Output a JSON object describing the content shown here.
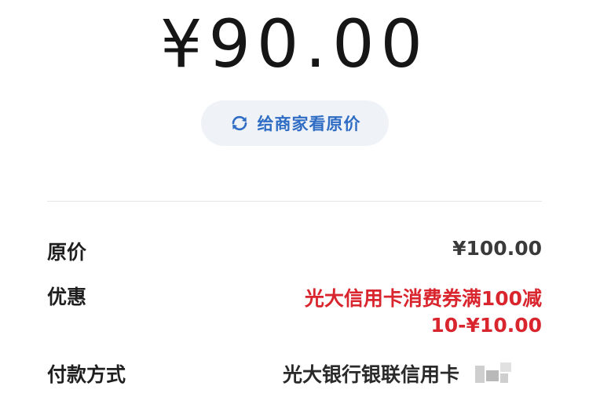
{
  "amount": "¥90.00",
  "show_original_button": {
    "label": "给商家看原价",
    "icon": "refresh-icon",
    "color": "#2f6dc4"
  },
  "details": {
    "original_price": {
      "label": "原价",
      "value": "¥100.00"
    },
    "discount": {
      "label": "优惠",
      "value_line1": "光大信用卡消费券满100减",
      "value_line2": "10-¥10.00",
      "color": "#d9252d"
    },
    "payment_method": {
      "label": "付款方式",
      "value": "光大银行银联信用卡"
    }
  }
}
